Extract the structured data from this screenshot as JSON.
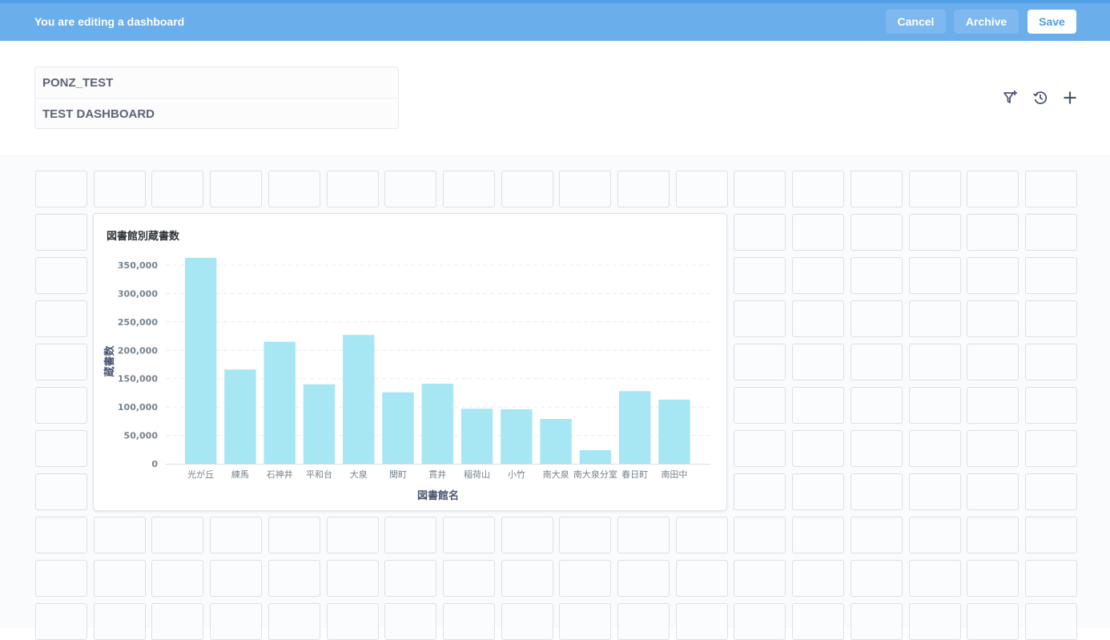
{
  "edit_bar": {
    "message": "You are editing a dashboard",
    "cancel_label": "Cancel",
    "archive_label": "Archive",
    "save_label": "Save"
  },
  "dashboard": {
    "collection": "PONZ_TEST",
    "name": "TEST DASHBOARD"
  },
  "header_icons": [
    "add-filter-icon",
    "history-icon",
    "add-question-icon"
  ],
  "colors": {
    "accent": "#509ee3",
    "bar": "#a7e7f3"
  },
  "card": {
    "title": "図書館別蔵書数"
  },
  "chart_data": {
    "type": "bar",
    "title": "図書館別蔵書数",
    "xlabel": "図書館名",
    "ylabel": "蔵書数",
    "categories": [
      "光が丘",
      "練馬",
      "石神井",
      "平和台",
      "大泉",
      "関町",
      "貫井",
      "稲荷山",
      "小竹",
      "南大泉",
      "南大泉分室",
      "春日町",
      "南田中"
    ],
    "values": [
      363000,
      166000,
      215000,
      140000,
      227000,
      126000,
      141000,
      97000,
      96000,
      79000,
      24000,
      128000,
      113000
    ],
    "ylim": [
      0,
      350000
    ],
    "yticks": [
      0,
      50000,
      100000,
      150000,
      200000,
      250000,
      300000,
      350000
    ],
    "ytick_labels": [
      "0",
      "50,000",
      "100,000",
      "150,000",
      "200,000",
      "250,000",
      "300,000",
      "350,000"
    ],
    "grid": true,
    "legend": "none"
  }
}
